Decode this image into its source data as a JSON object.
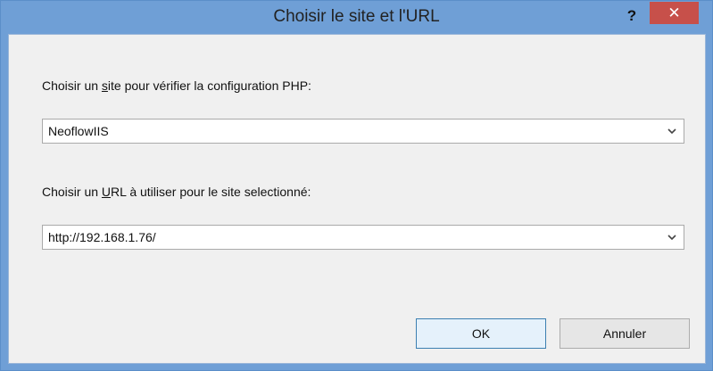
{
  "window": {
    "title": "Choisir le site et l'URL",
    "help_label": "?",
    "close_label": "✕"
  },
  "site_section": {
    "label_prefix": "Choisir un ",
    "label_mnemonic": "s",
    "label_suffix": "ite pour vérifier la configuration PHP:",
    "selected_value": "NeoflowIIS"
  },
  "url_section": {
    "label_prefix": "Choisir un ",
    "label_mnemonic": "U",
    "label_suffix": "RL à utiliser pour le site selectionné:",
    "selected_value": "http://192.168.1.76/"
  },
  "buttons": {
    "ok_label": "OK",
    "cancel_label": "Annuler"
  },
  "icons": {
    "dropdown": "chevron-down-icon"
  },
  "colors": {
    "titlebar": "#6f9fd6",
    "close_button": "#c7504a",
    "client_background": "#f0f0f0",
    "default_button_border": "#3c7fb1"
  }
}
